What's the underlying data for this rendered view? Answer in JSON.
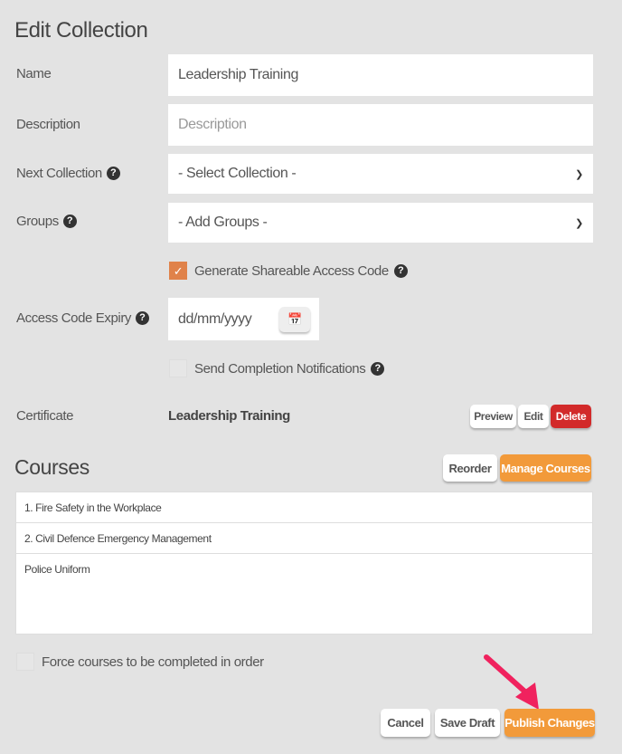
{
  "title": "Edit Collection",
  "fields": {
    "name": {
      "label": "Name",
      "value": "Leadership Training"
    },
    "description": {
      "label": "Description",
      "placeholder": "Description"
    },
    "next_collection": {
      "label": "Next Collection",
      "value": "- Select Collection -"
    },
    "groups": {
      "label": "Groups",
      "value": "- Add Groups -"
    },
    "shareable": {
      "label": "Generate Shareable Access Code",
      "checked": true
    },
    "expiry": {
      "label": "Access Code Expiry",
      "placeholder": "dd/mm/yyyy"
    },
    "notifications": {
      "label": "Send Completion Notifications",
      "checked": false
    },
    "certificate": {
      "label": "Certificate",
      "value": "Leadership Training",
      "preview": "Preview",
      "edit": "Edit",
      "delete": "Delete"
    }
  },
  "courses": {
    "heading": "Courses",
    "reorder": "Reorder",
    "manage": "Manage Courses",
    "items": [
      "1. Fire Safety in the Workplace",
      "2. Civil Defence Emergency Management",
      "Police Uniform"
    ]
  },
  "force_order": {
    "label": "Force courses to be completed in order",
    "checked": false
  },
  "footer": {
    "cancel": "Cancel",
    "save_draft": "Save Draft",
    "publish": "Publish Changes"
  },
  "colors": {
    "accent": "#f29a3a",
    "danger": "#d22a2a",
    "checkbox": "#e0824a",
    "arrow": "#f0225e"
  }
}
